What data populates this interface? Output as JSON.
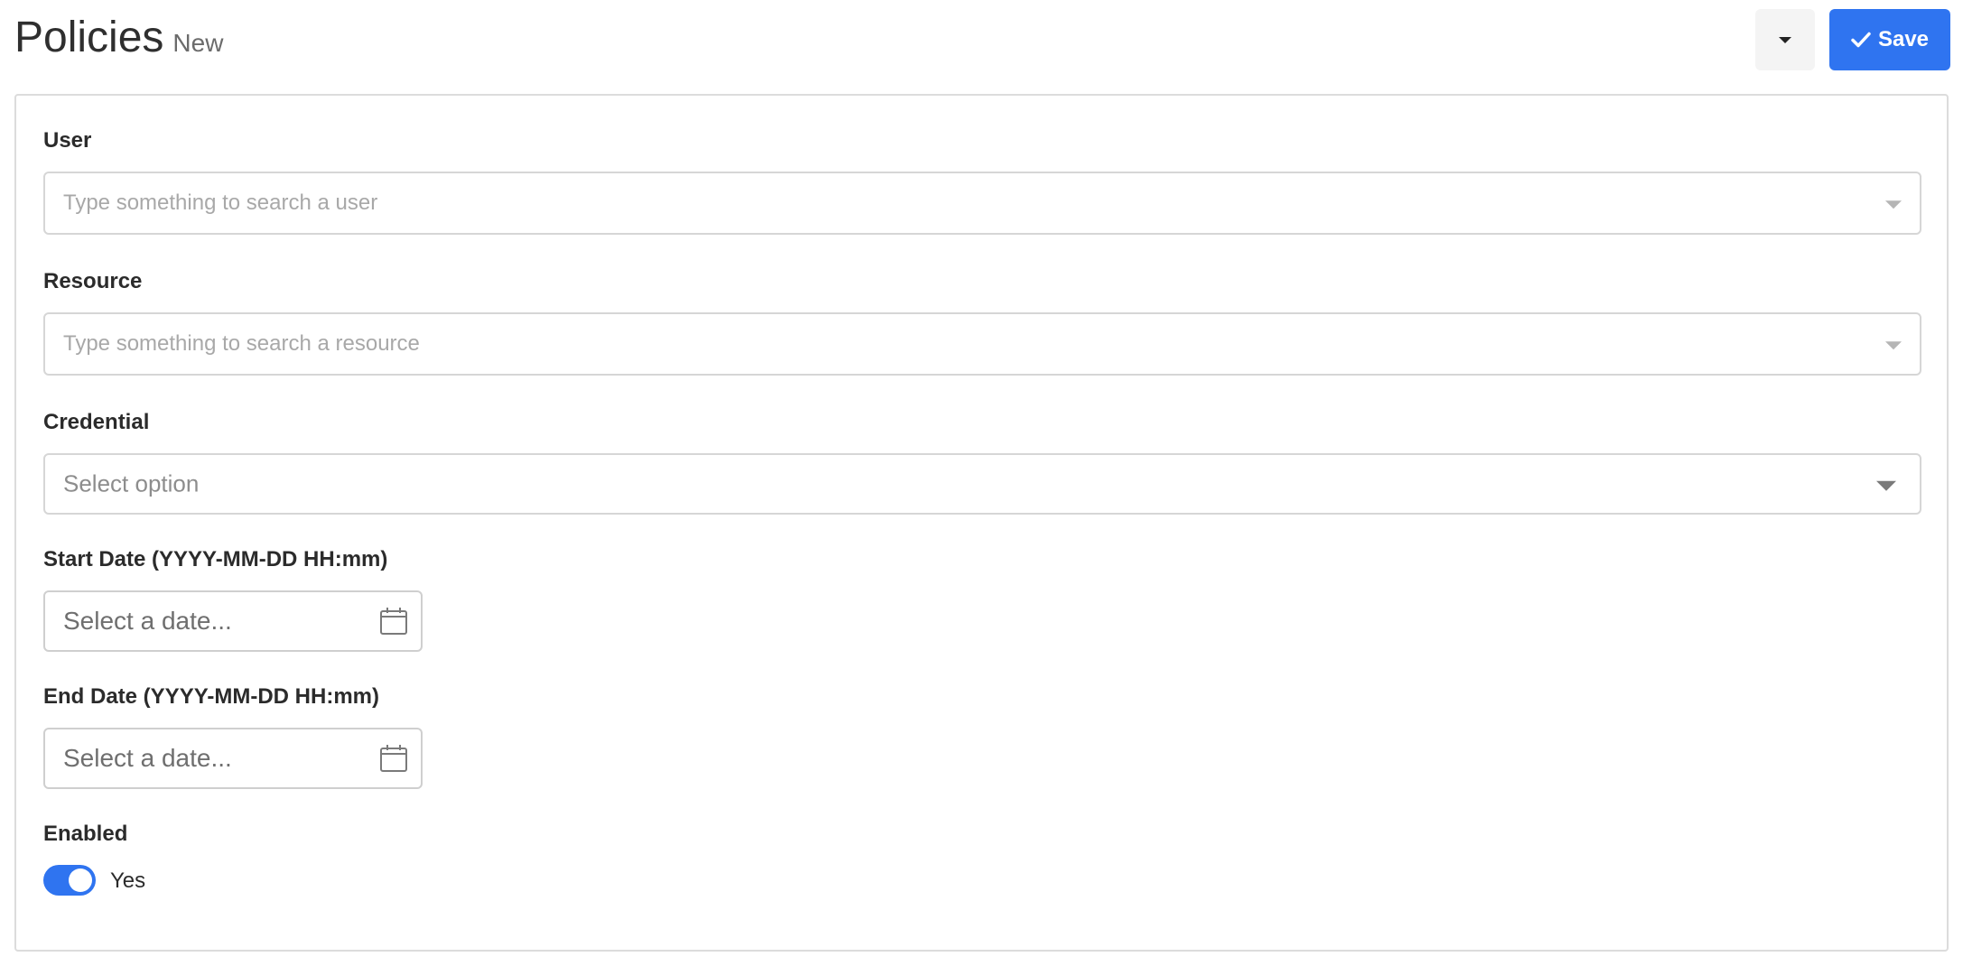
{
  "header": {
    "title": "Policies",
    "subtitle": "New",
    "save_label": "Save"
  },
  "form": {
    "user": {
      "label": "User",
      "placeholder": "Type something to search a user"
    },
    "resource": {
      "label": "Resource",
      "placeholder": "Type something to search a resource"
    },
    "credential": {
      "label": "Credential",
      "placeholder": "Select option"
    },
    "start_date": {
      "label": "Start Date (YYYY-MM-DD HH:mm)",
      "placeholder": "Select a date..."
    },
    "end_date": {
      "label": "End Date (YYYY-MM-DD HH:mm)",
      "placeholder": "Select a date..."
    },
    "enabled": {
      "label": "Enabled",
      "toggle_text": "Yes",
      "value": true
    }
  },
  "colors": {
    "accent": "#2f74f0",
    "border": "#d6d6d6",
    "placeholder": "#a8a8a8"
  },
  "icons": [
    "caret-down-icon",
    "check-icon",
    "calendar-icon",
    "toggle-switch"
  ]
}
